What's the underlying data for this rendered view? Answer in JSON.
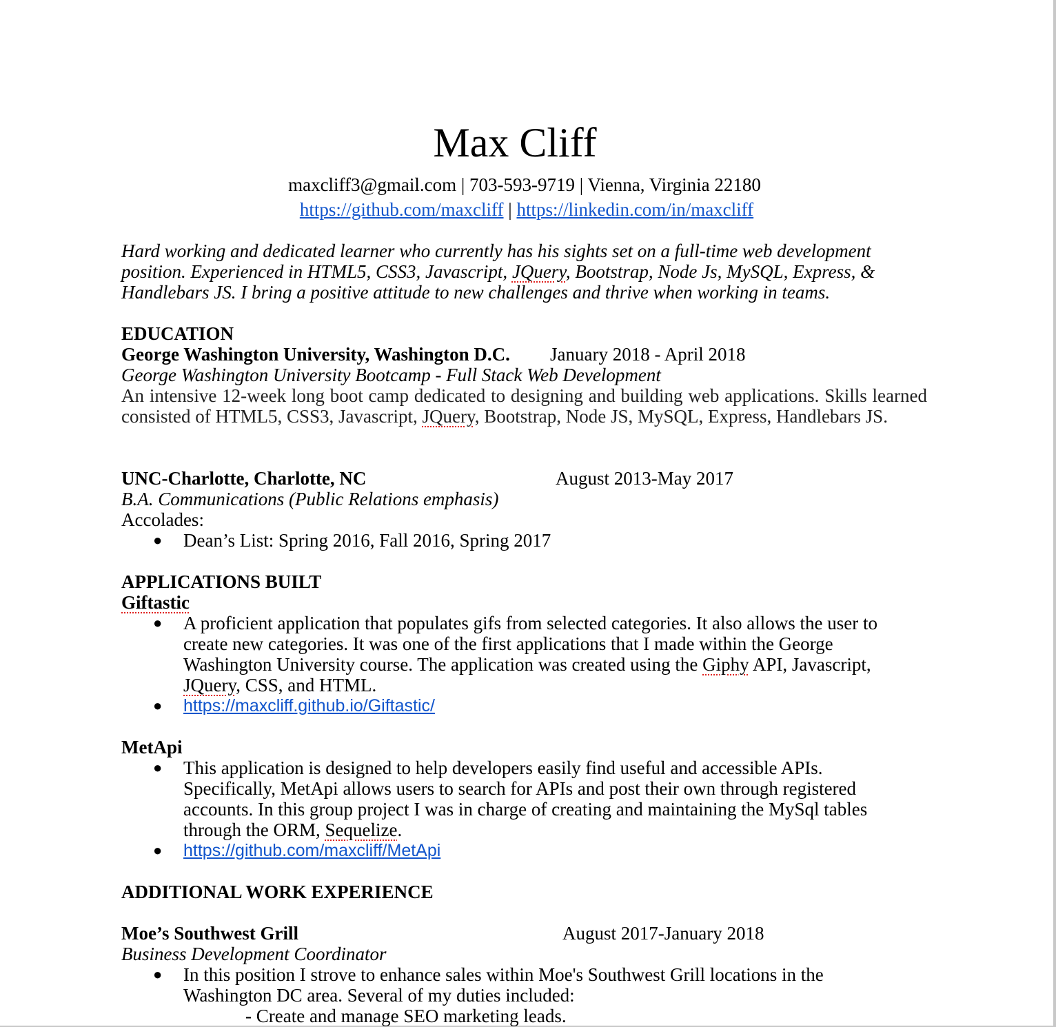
{
  "header": {
    "name": "Max Cliff",
    "contact": "maxcliff3@gmail.com | 703-593-9719 | Vienna, Virginia 22180",
    "github": "https://github.com/maxcliff",
    "separator": " | ",
    "linkedin": "https://linkedin.com/in/maxcliff "
  },
  "summary": {
    "part1": "Hard working and dedicated learner who currently has his sights set on a full-time web development position. Experienced in HTML5, CSS3, Javascript, ",
    "spell": "JQuery",
    "part2": ", Bootstrap, Node Js, MySQL,  Express, & Handlebars JS. I bring a positive attitude to new challenges and thrive when working in teams."
  },
  "education": {
    "heading": "EDUCATION",
    "gwu": {
      "school": "George Washington University, Washington D.C.",
      "dates": "January 2018 - April 2018",
      "program": "George Washington University  Bootcamp - Full Stack Web Development",
      "desc1": "An intensive 12-week long boot camp dedicated to designing and building web applications. Skills learned consisted of HTML5, CSS3, Javascript, ",
      "desc_spell": "JQuery",
      "desc2": ", Bootstrap, Node JS, MySQL, Express, Handlebars JS."
    },
    "unc": {
      "school": "UNC-Charlotte, Charlotte, NC",
      "dates": "August 2013-May 2017",
      "degree": "B.A. Communications (Public Relations emphasis)",
      "accolades_label": "Accolades:",
      "accolade_1": "Dean’s List: Spring 2016, Fall 2016, Spring 2017"
    }
  },
  "applications": {
    "heading": "APPLICATIONS BUILT",
    "giftastic": {
      "title": "Giftastic",
      "desc1": "A proficient application that populates gifs from selected categories. It also allows the user to create new categories. It was one of the first applications that I made within the George Washington University course. The application was created using the ",
      "spell1": "Giphy",
      "desc2": " API, Javascript, ",
      "spell2": "JQuery",
      "desc3": ", CSS, and HTML.",
      "link": "https://maxcliff.github.io/Giftastic/"
    },
    "metapi": {
      "title": "MetApi",
      "desc1": "This application is designed to help developers easily find useful and accessible APIs. Specifically, MetApi allows users to search for APIs and post their own through registered accounts. In this group project I was in charge of creating and maintaining the MySql tables through the ORM, ",
      "spell": "Sequelize",
      "desc2": ".",
      "link": "https://github.com/maxcliff/MetApi"
    }
  },
  "work": {
    "heading": "ADDITIONAL WORK EXPERIENCE",
    "moes": {
      "company": "Moe’s Southwest Grill",
      "dates": "August 2017-January 2018",
      "role": "Business Development Coordinator",
      "desc": "In this position I strove to enhance sales within Moe's Southwest Grill locations in the Washington DC area. Several of my duties included:",
      "duty_1": "- Create and manage SEO marketing leads."
    }
  },
  "bullet_glyph": "●"
}
